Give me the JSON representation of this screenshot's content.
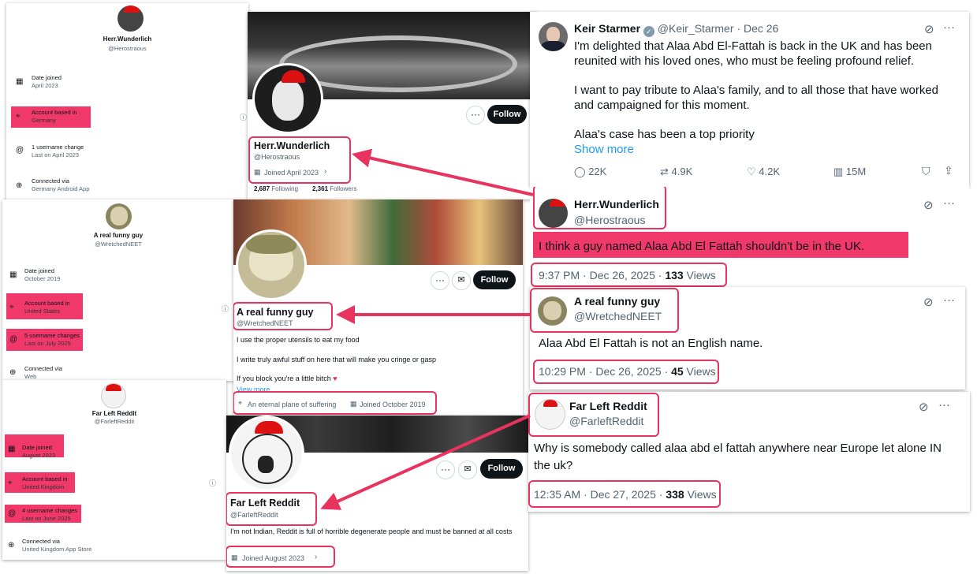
{
  "colors": {
    "highlight": "#e8335f",
    "pink_fill": "#f0386b",
    "link": "#1d9bf0",
    "text": "#0f1419",
    "muted": "#536471"
  },
  "about_panels": [
    {
      "display_name": "Herr.Wunderlich",
      "handle": "@Herostraous",
      "rows": [
        {
          "icon": "calendar-icon",
          "title": "Date joined",
          "sub": "April 2023"
        },
        {
          "icon": "location-icon",
          "title": "Account based in",
          "sub": "Germany"
        },
        {
          "icon": "at-icon",
          "title": "1 username change",
          "sub": "Last on April 2023"
        },
        {
          "icon": "globe-icon",
          "title": "Connected via",
          "sub": "Germany Android App"
        }
      ]
    },
    {
      "display_name": "A real funny guy",
      "handle": "@WretchedNEET",
      "rows": [
        {
          "icon": "calendar-icon",
          "title": "Date joined",
          "sub": "October 2019"
        },
        {
          "icon": "location-icon",
          "title": "Account based in",
          "sub": "United States"
        },
        {
          "icon": "at-icon",
          "title": "5 username changes",
          "sub": "Last on July 2025"
        },
        {
          "icon": "globe-icon",
          "title": "Connected via",
          "sub": "Web"
        }
      ]
    },
    {
      "display_name": "Far Left Reddit",
      "handle": "@FarleftReddit",
      "rows": [
        {
          "icon": "calendar-icon",
          "title": "Date joined",
          "sub": "August 2023"
        },
        {
          "icon": "location-icon",
          "title": "Account based in",
          "sub": "United Kingdom"
        },
        {
          "icon": "at-icon",
          "title": "4 username changes",
          "sub": "Last on June 2025"
        },
        {
          "icon": "globe-icon",
          "title": "Connected via",
          "sub": "United Kingdom App Store"
        }
      ]
    }
  ],
  "profiles": [
    {
      "name": "Herr.Wunderlich",
      "handle": "@Herostraous",
      "joined": "Joined April 2023",
      "following_count": "2,687",
      "following_label": "Following",
      "followers_count": "2,361",
      "followers_label": "Followers",
      "follow_label": "Follow"
    },
    {
      "name": "A real funny guy",
      "handle": "@WretchedNEET",
      "bio": [
        "I use the proper utensils to eat my food",
        "I write truly awful stuff on here that will make you cringe or gasp",
        "If you block you're a little bitch"
      ],
      "view_more": "View more",
      "location": "An eternal plane of suffering",
      "joined": "Joined October 2019",
      "follow_label": "Follow"
    },
    {
      "name": "Far Left Reddit",
      "handle": "@FarleftReddit",
      "bio": "I'm not Indian, Reddit is full of horrible degenerate people and must be banned at all costs",
      "joined": "Joined August 2023",
      "follow_label": "Follow"
    }
  ],
  "main_tweet": {
    "name": "Keir Starmer",
    "handle": "@Keir_Starmer",
    "sep": "·",
    "date": "Dec 26",
    "p1": "I'm delighted that Alaa Abd El-Fattah is back in the UK and has been reunited with his loved ones, who must be feeling profound relief.",
    "p2": "I want to pay tribute to Alaa's family, and to all those that have worked and campaigned for this moment.",
    "p3": "Alaa's case has been a top priority",
    "show_more": "Show more",
    "replies": "22K",
    "reposts": "4.9K",
    "likes": "4.2K",
    "views": "15M"
  },
  "replies": [
    {
      "name": "Herr.Wunderlich",
      "handle": "@Herostraous",
      "text": "I think a guy named Alaa Abd El Fattah shouldn't be in the UK.",
      "time": "9:37 PM · Dec 26, 2025 · ",
      "views_count": "133",
      "views_label": " Views"
    },
    {
      "name": "A real funny guy",
      "handle": "@WretchedNEET",
      "text": "Alaa Abd El Fattah is not an English name.",
      "time": "10:29 PM · Dec 26, 2025 · ",
      "views_count": "45",
      "views_label": " Views"
    },
    {
      "name": "Far Left Reddit",
      "handle": "@FarleftReddit",
      "text": "Why is somebody called alaa abd el fattah anywhere near Europe let alone IN the uk?",
      "time": "12:35 AM · Dec 27, 2025 · ",
      "views_count": "338",
      "views_label": " Views"
    }
  ]
}
